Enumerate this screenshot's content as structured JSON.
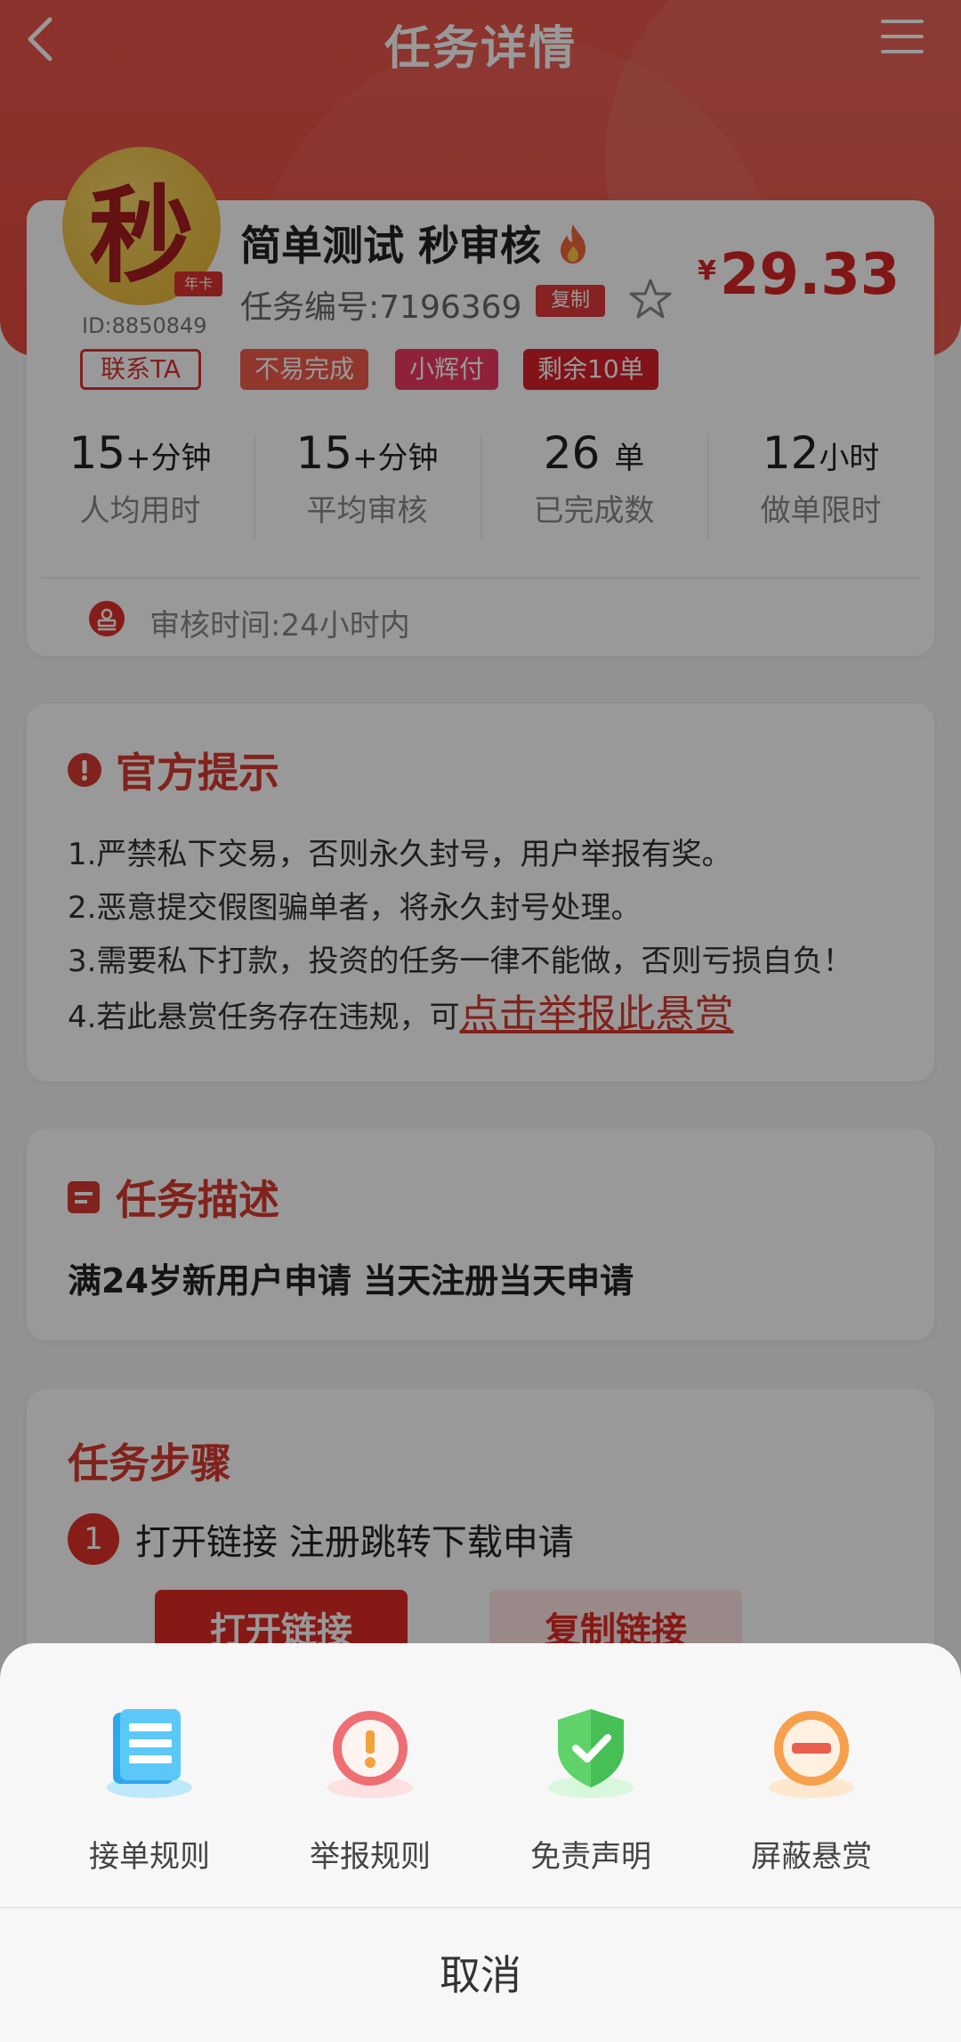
{
  "header": {
    "title": "任务详情"
  },
  "task": {
    "avatar_char": "秒",
    "avatar_badge": "年卡",
    "user_id": "ID:8850849",
    "contact_label": "联系TA",
    "name": "简单测试 秒审核",
    "task_no": "任务编号:7196369",
    "copy_label": "复制",
    "price_symbol": "¥",
    "price": "29.33",
    "tags": [
      "不易完成",
      "小辉付",
      "剩余10单"
    ],
    "stats": [
      {
        "value": "15",
        "unit": "+分钟",
        "label": "人均用时"
      },
      {
        "value": "15",
        "unit": "+分钟",
        "label": "平均审核"
      },
      {
        "value": "26",
        "unit": "单",
        "label": "已完成数"
      },
      {
        "value": "12",
        "unit": "小时",
        "label": "做单限时"
      }
    ],
    "review_time": "审核时间:24小时内"
  },
  "tips": {
    "title": "官方提示",
    "items": [
      "1.严禁私下交易，否则永久封号，用户举报有奖。",
      "2.恶意提交假图骗单者，将永久封号处理。",
      "3.需要私下打款，投资的任务一律不能做，否则亏损自负！",
      "4.若此悬赏任务存在违规，可"
    ],
    "report_link": "点击举报此悬赏"
  },
  "description": {
    "title": "任务描述",
    "text": "满24岁新用户申请  当天注册当天申请"
  },
  "steps": {
    "title": "任务步骤",
    "step1_num": "1",
    "step1_text": "打开链接 注册跳转下载申请",
    "open_link_label": "打开链接",
    "copy_link_label": "复制链接"
  },
  "sheet": {
    "actions": [
      {
        "label": "接单规则",
        "icon": "rules-doc-icon"
      },
      {
        "label": "举报规则",
        "icon": "warning-icon"
      },
      {
        "label": "免责声明",
        "icon": "shield-check-icon"
      },
      {
        "label": "屏蔽悬赏",
        "icon": "block-icon"
      }
    ],
    "cancel_label": "取消"
  },
  "colors": {
    "brand_red": "#e64b40",
    "accent": "#d83a2f"
  }
}
